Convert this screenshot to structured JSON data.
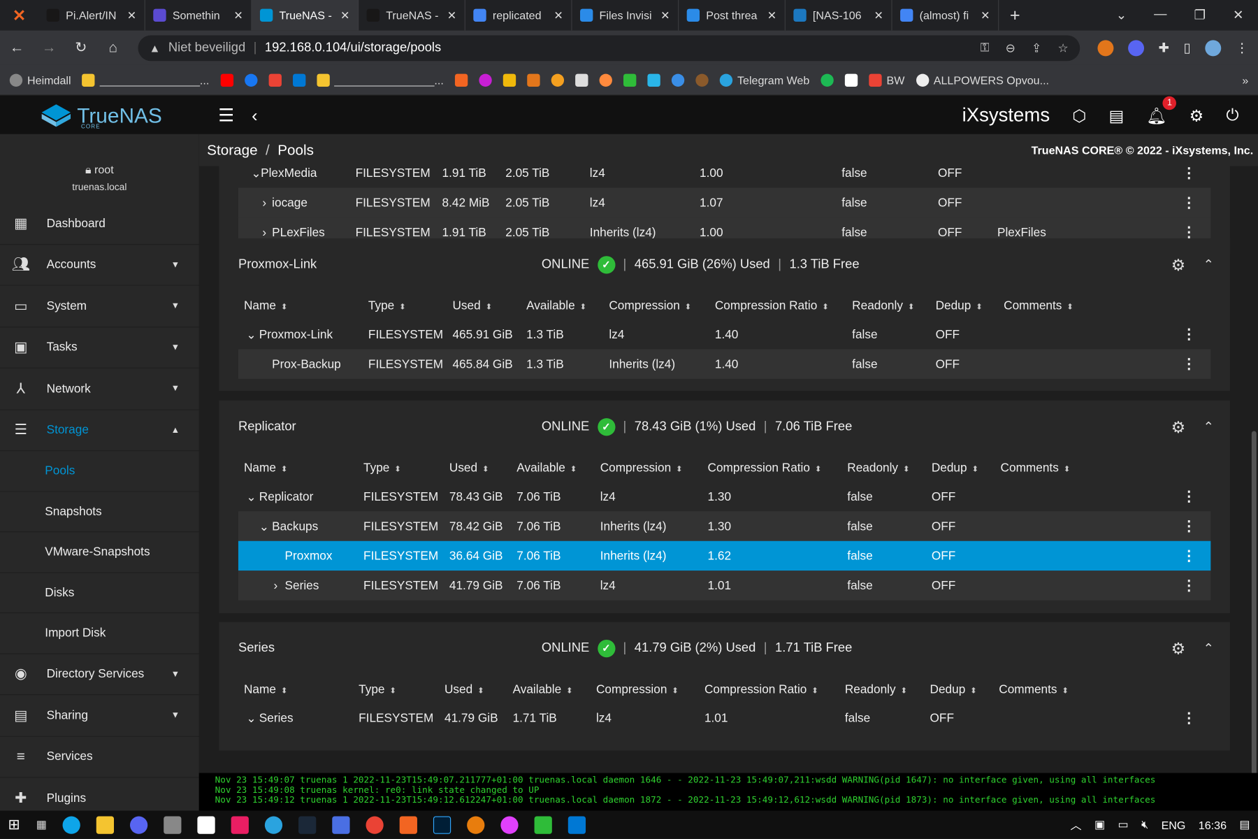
{
  "browser": {
    "tabs": [
      {
        "label": "Pi.Alert/IN",
        "active": false
      },
      {
        "label": "Somethin",
        "active": false
      },
      {
        "label": "TrueNAS -",
        "active": true
      },
      {
        "label": "TrueNAS -",
        "active": false
      },
      {
        "label": "replicated",
        "active": false
      },
      {
        "label": "Files Invisi",
        "active": false
      },
      {
        "label": "Post threa",
        "active": false
      },
      {
        "label": "[NAS-106",
        "active": false
      },
      {
        "label": "(almost) fi",
        "active": false
      }
    ],
    "insecure_label": "Niet beveiligd",
    "url": "192.168.0.104/ui/storage/pools",
    "bookmarks": [
      "Heimdall",
      "________________...",
      "________________...",
      "Telegram Web",
      "BW",
      "ALLPOWERS Opvou..."
    ]
  },
  "app": {
    "brand": "TrueNAS",
    "edition": "CORE",
    "vendor": "iXsystems",
    "notification_count": "1",
    "user": "root",
    "host": "truenas.local"
  },
  "sidebar": {
    "items": [
      {
        "label": "Dashboard",
        "icon": "dashboard-icon"
      },
      {
        "label": "Accounts",
        "icon": "accounts-icon"
      },
      {
        "label": "System",
        "icon": "system-icon"
      },
      {
        "label": "Tasks",
        "icon": "tasks-icon"
      },
      {
        "label": "Network",
        "icon": "network-icon"
      },
      {
        "label": "Storage",
        "icon": "storage-icon"
      }
    ],
    "storage_sub": [
      "Pools",
      "Snapshots",
      "VMware-Snapshots",
      "Disks",
      "Import Disk"
    ],
    "items_after": [
      {
        "label": "Directory Services"
      },
      {
        "label": "Sharing"
      },
      {
        "label": "Services"
      },
      {
        "label": "Plugins"
      }
    ]
  },
  "breadcrumb": {
    "section": "Storage",
    "page": "Pools"
  },
  "copyright": "TrueNAS CORE® © 2022 - iXsystems, Inc.",
  "columns": [
    "Name",
    "Type",
    "Used",
    "Available",
    "Compression",
    "Compression Ratio",
    "Readonly",
    "Dedup",
    "Comments"
  ],
  "top_partial_rows": [
    {
      "name": "PlexMedia",
      "type": "FILESYSTEM",
      "used": "1.91 TiB",
      "available": "2.05 TiB",
      "compression": "lz4",
      "ratio": "1.00",
      "readonly": "false",
      "dedup": "OFF",
      "comments": ""
    },
    {
      "name": "iocage",
      "type": "FILESYSTEM",
      "used": "8.42 MiB",
      "available": "2.05 TiB",
      "compression": "lz4",
      "ratio": "1.07",
      "readonly": "false",
      "dedup": "OFF",
      "comments": ""
    },
    {
      "name": "PLexFiles",
      "type": "FILESYSTEM",
      "used": "1.91 TiB",
      "available": "2.05 TiB",
      "compression": "Inherits (lz4)",
      "ratio": "1.00",
      "readonly": "false",
      "dedup": "OFF",
      "comments": "PlexFiles"
    }
  ],
  "pools": [
    {
      "name": "Proxmox-Link",
      "status": "ONLINE",
      "used": "465.91 GiB (26%) Used",
      "free": "1.3 TiB Free",
      "rows": [
        {
          "name": "Proxmox-Link",
          "type": "FILESYSTEM",
          "used": "465.91 GiB",
          "available": "1.3 TiB",
          "compression": "lz4",
          "ratio": "1.40",
          "readonly": "false",
          "dedup": "OFF"
        },
        {
          "name": "Prox-Backup",
          "type": "FILESYSTEM",
          "used": "465.84 GiB",
          "available": "1.3 TiB",
          "compression": "Inherits (lz4)",
          "ratio": "1.40",
          "readonly": "false",
          "dedup": "OFF"
        }
      ]
    },
    {
      "name": "Replicator",
      "status": "ONLINE",
      "used": "78.43 GiB (1%) Used",
      "free": "7.06 TiB Free",
      "rows": [
        {
          "name": "Replicator",
          "type": "FILESYSTEM",
          "used": "78.43 GiB",
          "available": "7.06 TiB",
          "compression": "lz4",
          "ratio": "1.30",
          "readonly": "false",
          "dedup": "OFF"
        },
        {
          "name": "Backups",
          "type": "FILESYSTEM",
          "used": "78.42 GiB",
          "available": "7.06 TiB",
          "compression": "Inherits (lz4)",
          "ratio": "1.30",
          "readonly": "false",
          "dedup": "OFF"
        },
        {
          "name": "Proxmox",
          "type": "FILESYSTEM",
          "used": "36.64 GiB",
          "available": "7.06 TiB",
          "compression": "Inherits (lz4)",
          "ratio": "1.62",
          "readonly": "false",
          "dedup": "OFF"
        },
        {
          "name": "Series",
          "type": "FILESYSTEM",
          "used": "41.79 GiB",
          "available": "7.06 TiB",
          "compression": "lz4",
          "ratio": "1.01",
          "readonly": "false",
          "dedup": "OFF"
        }
      ]
    },
    {
      "name": "Series",
      "status": "ONLINE",
      "used": "41.79 GiB (2%) Used",
      "free": "1.71 TiB Free",
      "rows": [
        {
          "name": "Series",
          "type": "FILESYSTEM",
          "used": "41.79 GiB",
          "available": "1.71 TiB",
          "compression": "lz4",
          "ratio": "1.01",
          "readonly": "false",
          "dedup": "OFF"
        }
      ]
    }
  ],
  "console_lines": [
    "Nov 23 15:49:07 truenas 1 2022-11-23T15:49:07.211777+01:00 truenas.local daemon 1646 - - 2022-11-23 15:49:07,211:wsdd WARNING(pid 1647): no interface given, using all interfaces",
    "Nov 23 15:49:08 truenas kernel: re0: link state changed to UP",
    "Nov 23 15:49:12 truenas 1 2022-11-23T15:49:12.612247+01:00 truenas.local daemon 1872 - - 2022-11-23 15:49:12,612:wsdd WARNING(pid 1873): no interface given, using all interfaces"
  ],
  "taskbar": {
    "lang": "ENG",
    "time": "16:36"
  },
  "colors": {
    "accent": "#0095d5",
    "online": "#2fbc39",
    "console_text": "#2fd12f",
    "badge": "#e0202a"
  }
}
